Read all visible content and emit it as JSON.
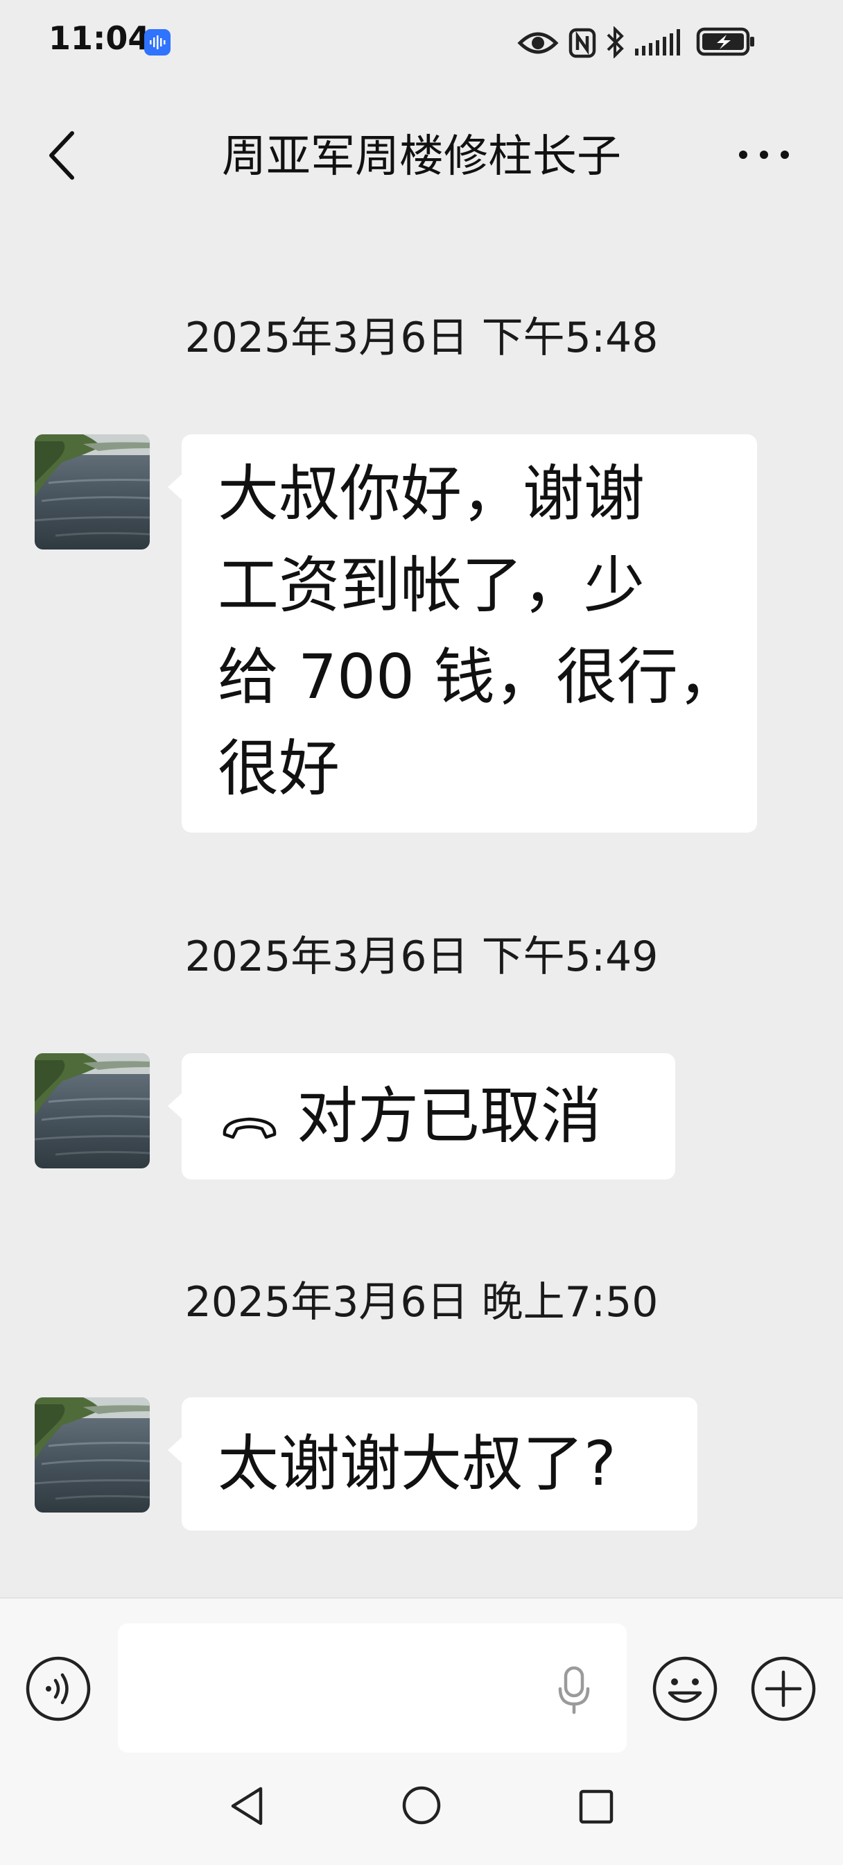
{
  "status_bar": {
    "time": "11:04",
    "icons": [
      "audio-app-icon",
      "eye-icon",
      "nfc-icon",
      "bluetooth-icon",
      "signal-icon",
      "battery-charging-icon"
    ]
  },
  "header": {
    "title": "周亚军周楼修柱长子",
    "back_icon": "chevron-left-icon",
    "more_icon": "more-dots-icon"
  },
  "messages": [
    {
      "timestamp": "2025年3月6日 下午5:48",
      "type": "text",
      "lines": [
        "大叔你好，谢谢",
        "工资到帐了，少",
        "给 700 钱，很行，",
        "很好"
      ]
    },
    {
      "timestamp": "2025年3月6日 下午5:49",
      "type": "call",
      "icon": "hang-up-phone-icon",
      "text": "对方已取消"
    },
    {
      "timestamp": "2025年3月6日 晚上7:50",
      "type": "text",
      "lines": [
        "太谢谢大叔了?"
      ]
    }
  ],
  "input_bar": {
    "value": "",
    "icons": [
      "voice-mode-icon",
      "microphone-icon",
      "emoji-icon",
      "plus-icon"
    ]
  },
  "nav_bar": {
    "icons": [
      "nav-back-icon",
      "nav-home-icon",
      "nav-recent-icon"
    ]
  },
  "colors": {
    "background": "#ededed",
    "bubble": "#ffffff",
    "input_bar": "#f7f7f7",
    "status_badge": "#2f73ff"
  }
}
